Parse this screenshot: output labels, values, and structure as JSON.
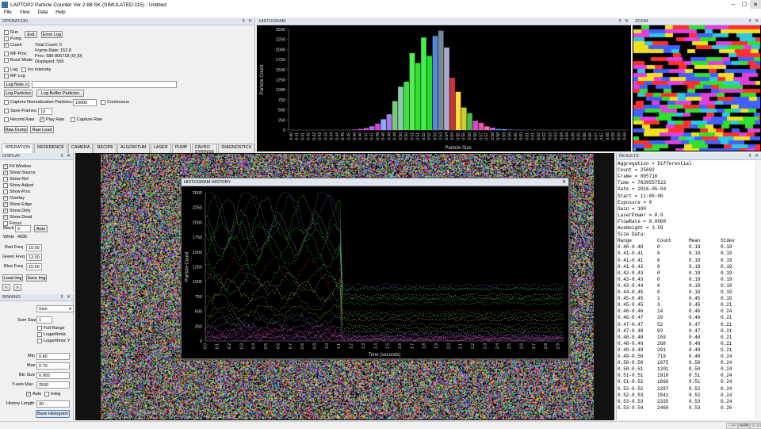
{
  "app": {
    "title": "LAPTOP2  Particle Counter Ver 2.88 SK (SIMULATED:115) - Untitled",
    "menu": [
      "File",
      "View",
      "Data",
      "Help"
    ],
    "window_buttons": [
      "–",
      "☐",
      "✕"
    ]
  },
  "operation": {
    "title": "OPERATION",
    "run": "Run",
    "pump": "Pump",
    "count": "Count",
    "mf_proc": "MF Proc",
    "burst_mode": "Burst Mode",
    "exit_btn": "Exit",
    "error_log_btn": "Error Log",
    "total_count": "Total Count: 0",
    "frame_rate": "Frame Rate: 152.8",
    "proc": "Proc: 586 805718 (0) [0]",
    "displayed": "Displayed: 556",
    "log": "Log",
    "inc_intensity": "Inc Intensity",
    "mf_log": "MF Log",
    "log_note_btn": "Log Note >",
    "log_particles_btn": "Log Particles",
    "log_buffer_btn": "Log Buffer Particles",
    "capture_norm": "Capture Normalization Particles:",
    "capture_norm_value": "10000",
    "continuous": "Continuous",
    "save_frames": "Save Frames:",
    "save_frames_value": "10",
    "record_raw": "Record Raw",
    "play_raw": "Play Raw",
    "capture_raw": "Capture Raw",
    "raw_dump_btn": "Raw Dump",
    "raw_load_btn": "Raw Load"
  },
  "tabs": [
    "OPERATION",
    "REFERENCE",
    "CAMERA",
    "RECIPE",
    "ALGORITHM",
    "LASER",
    "PUMP",
    "CAVRO SYRINGE",
    "DIAGNOSTICS"
  ],
  "display": {
    "title": "DISPLAY",
    "checks": [
      {
        "label": "Fit Window",
        "checked": true
      },
      {
        "label": "Show Source",
        "checked": true
      },
      {
        "label": "Show Ref",
        "checked": false
      },
      {
        "label": "Show Adjust",
        "checked": false
      },
      {
        "label": "Show Proc",
        "checked": false
      },
      {
        "label": "Overlay",
        "checked": true
      },
      {
        "label": "Show Edge",
        "checked": true
      },
      {
        "label": "Show Dirty",
        "checked": true
      },
      {
        "label": "Show Dead",
        "checked": true
      },
      {
        "label": "Focus",
        "checked": false
      }
    ],
    "black_label": "Black",
    "black_value": "2",
    "auto_btn": "Auto",
    "white_label": "White",
    "white_value": "4095",
    "red_freq_label": "Red Freq",
    "red_freq": "10.00",
    "green_freq_label": "Green Freq",
    "green_freq": "13.00",
    "blue_freq_label": "Blue Freq",
    "blue_freq": "15.00",
    "load_img": "Load Img",
    "save_img": "Save Img",
    "prev": "<",
    "next": ">"
  },
  "binning": {
    "title": "BINNING",
    "mode": "Size",
    "sum_size_label": "Sum Size",
    "sum_size": "1",
    "full_range": "Full Range",
    "log_x": "Logarithmic",
    "log_y": "Logarithmic Y",
    "min_label": "Min",
    "min": "0.40",
    "max_label": "Max",
    "max": "0.70",
    "bin_size_label": "Bin Size",
    "bin_size": "0.005",
    "yaxis_label": "Y-axis Max",
    "yaxis_max": "2500",
    "auto": "Auto",
    "integ": "Integ",
    "history_label": "History Length",
    "history": "30",
    "base_histogram_btn": "Base Histogram"
  },
  "histogram_panel": {
    "title": "HISTOGRAM"
  },
  "zoom_panel": {
    "title": "ZOOM"
  },
  "results_panel": {
    "title": "RESULTS"
  },
  "history_window": {
    "title": "HISTOGRAM HISTORY",
    "close": "✕"
  },
  "results": {
    "header": [
      "Aggregation = Differential",
      "Count = 25602",
      "Frame = 805716",
      "Time = 7839557522",
      "Date = 2016-05-04",
      "Start = 11:05:00",
      "Exposure = 0",
      "Gain = 100",
      "LaserPower = 0.0",
      "FlowRate = 0.0000",
      "AveHeight = 3.59",
      "Size Data:"
    ],
    "columns": [
      "Range",
      "Count",
      "Mean",
      "Stdev"
    ],
    "rows": [
      [
        "0.40-0.40",
        "0",
        "0.19",
        "0.19"
      ],
      [
        "0.41-0.41",
        "0",
        "0.19",
        "0.19"
      ],
      [
        "0.41-0.41",
        "0",
        "0.19",
        "0.19"
      ],
      [
        "0.41-0.42",
        "0",
        "0.19",
        "0.19"
      ],
      [
        "0.42-0.43",
        "0",
        "0.19",
        "0.19"
      ],
      [
        "0.43-0.43",
        "0",
        "0.19",
        "0.19"
      ],
      [
        "0.43-0.44",
        "0",
        "0.19",
        "0.19"
      ],
      [
        "0.44-0.45",
        "0",
        "0.19",
        "0.19"
      ],
      [
        "0.45-0.45",
        "1",
        "0.45",
        "0.19"
      ],
      [
        "0.45-0.45",
        "3",
        "0.45",
        "0.21"
      ],
      [
        "0.46-0.46",
        "14",
        "0.46",
        "0.24"
      ],
      [
        "0.46-0.47",
        "29",
        "0.46",
        "0.21"
      ],
      [
        "0.47-0.47",
        "52",
        "0.47",
        "0.21"
      ],
      [
        "0.47-0.48",
        "93",
        "0.47",
        "0.21"
      ],
      [
        "0.48-0.48",
        "159",
        "0.48",
        "0.21"
      ],
      [
        "0.48-0.49",
        "268",
        "0.48",
        "0.21"
      ],
      [
        "0.49-0.49",
        "391",
        "0.49",
        "0.21"
      ],
      [
        "0.49-0.50",
        "719",
        "0.49",
        "0.24"
      ],
      [
        "0.50-0.50",
        "1075",
        "0.50",
        "0.24"
      ],
      [
        "0.50-0.51",
        "1201",
        "0.50",
        "0.24"
      ],
      [
        "0.51-0.51",
        "1910",
        "0.51",
        "0.24"
      ],
      [
        "0.51-0.52",
        "1666",
        "0.51",
        "0.24"
      ],
      [
        "0.52-0.52",
        "2297",
        "0.52",
        "0.24"
      ],
      [
        "0.52-0.53",
        "1841",
        "0.52",
        "0.24"
      ],
      [
        "0.53-0.53",
        "2335",
        "0.53",
        "0.24"
      ],
      [
        "0.53-0.54",
        "2469",
        "0.53",
        "0.26"
      ]
    ]
  },
  "status": [
    "CAP",
    "NUM",
    "SCRL"
  ],
  "chart_data": [
    {
      "type": "bar",
      "name": "histogram",
      "xlabel": "Particle Size",
      "ylabel": "Particle Count",
      "ylim": [
        0,
        2500
      ],
      "yticks": [
        0,
        250,
        500,
        750,
        1000,
        1250,
        1500,
        1750,
        2000,
        2250,
        2500
      ],
      "categories": [
        "0.40",
        "0.41",
        "0.41",
        "0.42",
        "0.42",
        "0.43",
        "0.43",
        "0.44",
        "0.44",
        "0.45",
        "0.45",
        "0.46",
        "0.46",
        "0.47",
        "0.47",
        "0.48",
        "0.48",
        "0.49",
        "0.49",
        "0.50",
        "0.50",
        "0.51",
        "0.51",
        "0.52",
        "0.52",
        "0.53",
        "0.53",
        "0.54",
        "0.54",
        "0.55",
        "0.55",
        "0.56",
        "0.56",
        "0.57",
        "0.57",
        "0.58",
        "0.58",
        "0.59",
        "0.59",
        "0.60",
        "0.60",
        "0.61",
        "0.61",
        "0.62",
        "0.62",
        "0.63",
        "0.63",
        "0.64",
        "0.64",
        "0.65",
        "0.65",
        "0.66",
        "0.66",
        "0.67",
        "0.67",
        "0.68",
        "0.68",
        "0.69",
        "0.69"
      ],
      "values": [
        0,
        0,
        0,
        0,
        0,
        0,
        0,
        0,
        0,
        1,
        3,
        14,
        29,
        52,
        93,
        159,
        268,
        391,
        719,
        1075,
        1201,
        1910,
        1666,
        2297,
        1841,
        2335,
        2469,
        2050,
        1300,
        950,
        560,
        420,
        230,
        180,
        90,
        60,
        30,
        20,
        12,
        8,
        5,
        3,
        2,
        1,
        1,
        0,
        0,
        0,
        0,
        0,
        0,
        0,
        0,
        0,
        0,
        0,
        0,
        0,
        0
      ],
      "colors": [
        "#8844ff",
        "#8844ff",
        "#8844ff",
        "#8844ff",
        "#8844ff",
        "#8844ff",
        "#8844ff",
        "#8844ff",
        "#8844ff",
        "#cc44cc",
        "#cc44cc",
        "#cc44cc",
        "#bb55dd",
        "#cc55cc",
        "#aa66ee",
        "#cc44cc",
        "#88aaff",
        "#aa77ee",
        "#77cc77",
        "#88ccaa",
        "#44dd44",
        "#55ee55",
        "#33dd33",
        "#44ee55",
        "#22dd22",
        "#5588dd",
        "#778899",
        "#aaaacc",
        "#cc3333",
        "#ffdd44",
        "#cccc33",
        "#44bb44",
        "#dd44cc",
        "#ee55aa",
        "#ff66aa",
        "#aa66ff",
        "#4488ff",
        "#55ccff",
        "#6688ff",
        "#8866ff",
        "#cc44cc",
        "#dd55bb",
        "#6699ff",
        "#8877ff",
        "#cc55cc",
        "#8844ff",
        "#8844ff",
        "#8844ff",
        "#8844ff",
        "#8844ff",
        "#8844ff",
        "#8844ff",
        "#8844ff",
        "#8844ff",
        "#8844ff",
        "#8844ff",
        "#8844ff",
        "#8844ff",
        "#8844ff"
      ]
    },
    {
      "type": "scatter",
      "name": "histogram-history",
      "xlabel": "Time (seconds)",
      "ylabel": "Particle Count",
      "ylim": [
        0,
        2500
      ],
      "yticks": [
        0,
        250,
        500,
        750,
        1000,
        1250,
        1500,
        1750,
        2000,
        2250,
        2500
      ],
      "xticks": [
        "0.0",
        "0.1",
        "0.2",
        "0.3",
        "0.4",
        "0.5",
        "0.6",
        "0.7",
        "0.8",
        "0.9",
        "1.0",
        "1.1",
        "1.2",
        "1.3",
        "1.4",
        "1.5",
        "1.6",
        "1.7",
        "1.8",
        "1.9",
        "2.0",
        "2.1",
        "2.2",
        "2.3",
        "2.4",
        "2.5",
        "2.6",
        "2.7",
        "2.8",
        "2.9"
      ]
    }
  ]
}
